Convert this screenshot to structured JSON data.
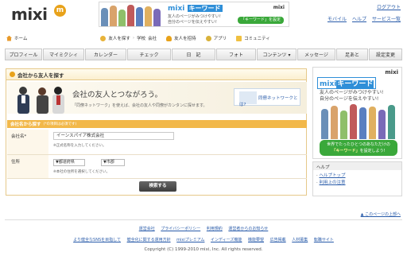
{
  "header": {
    "logo_text": "mixi",
    "logo_badge": "m",
    "banner": {
      "title_prefix": "mixi",
      "title_keyword": "キーワード",
      "line1": "友人のページがみつけやすい!",
      "line2": "自分のページを伝えやすい!",
      "button": "「キーワード」を設定",
      "logo": "mixi"
    },
    "logout": "ログアウト",
    "links": [
      "モバイル",
      "ヘルプ",
      "サービス一覧"
    ]
  },
  "nav": {
    "home": "ホーム",
    "find_friends": "友人を探す",
    "school": "学校",
    "company": "会社",
    "invite": "友人を招待",
    "apps": "アプリ",
    "community": "コミュニティ"
  },
  "menu": [
    "プロフィール",
    "マイミクシィ",
    "カレンダー",
    "チェック",
    "日　記",
    "フォト",
    "コンテンツ ▾",
    "メッセージ",
    "足あと",
    "設定変更"
  ],
  "main": {
    "heading": "会社から友人を探す",
    "hero_title": "会社の友人とつながろう。",
    "hero_sub": "「同僚ネットワーク」を使えば、会社の友人や同僚がカンタンに探せます。",
    "hero_badge": "同僚ネットワークとは?",
    "form_head": "会社名から探す",
    "form_head_note": "(*の項目は必須です)",
    "company_label": "会社名*",
    "company_value": "イーンスパイア株式会社",
    "company_hint": "※正式名称を入力してください。",
    "address_label": "住所",
    "pref_select": "▼都道府県",
    "city_select": "▼市郡",
    "address_hint": "※本社の住所を選択してください。",
    "search_button": "検索する"
  },
  "ad": {
    "logo": "mixi",
    "kw_prefix": "mixi",
    "kw": "キーワード",
    "line1": "友人のページがみつけやすい!",
    "line2": "自分のページを伝えやすい!",
    "btn_line1": "世界でたったひとつのあなただけの",
    "btn_kw": "「キーワード」",
    "btn_line2": "を設定しよう!"
  },
  "help": {
    "title": "ヘルプ",
    "links": [
      "ヘルプトップ",
      "利用上の注意"
    ]
  },
  "pagetop": "▲ このページの上部へ",
  "footer": {
    "row1": [
      "運営会社",
      "プライバシーポリシー",
      "利用規約",
      "運営者からのお知らせ"
    ],
    "row2": [
      "より健全なSNSを目指して",
      "健全化に関する運用方針",
      "mixiプレミアム",
      "インディーズ機能",
      "機能要望",
      "広告掲載",
      "人材募集",
      "転職サイト"
    ],
    "copyright": "Copyright (C) 1999-2010 mixi, Inc. All rights reserved."
  },
  "colors": {
    "accent_orange": "#f2b84a",
    "link_blue": "#2a5caa",
    "keyword_blue": "#2f8fd8",
    "button_green": "#3aa83a"
  }
}
